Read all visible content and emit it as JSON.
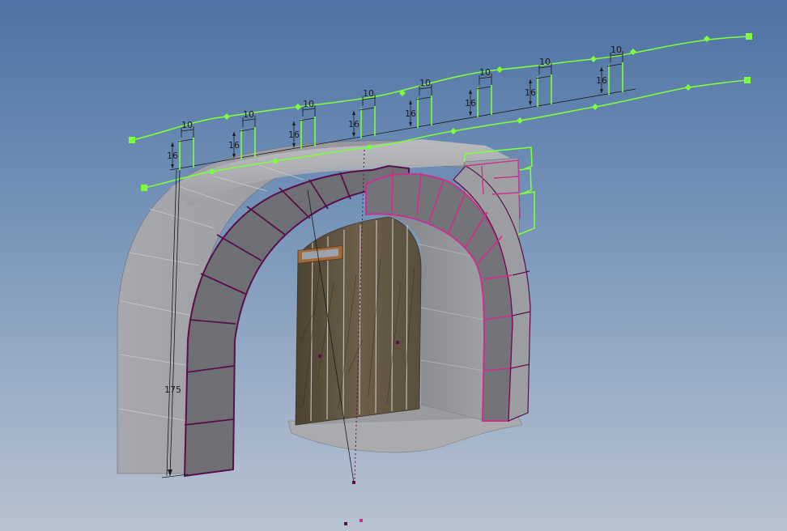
{
  "colors": {
    "sketch": "#7dff3a",
    "selection": "#c8328c",
    "edge": "#5a0f4a",
    "dimension": "#1a1a1a",
    "stone": "#8a8c91",
    "stone_light": "#a3a5aa",
    "wood": "#5d5140",
    "background_top": "#4d72a3",
    "background_bottom": "#b8c3d0"
  },
  "dimensions": {
    "block_height": "16",
    "block_width": "10",
    "total_height": "175"
  }
}
